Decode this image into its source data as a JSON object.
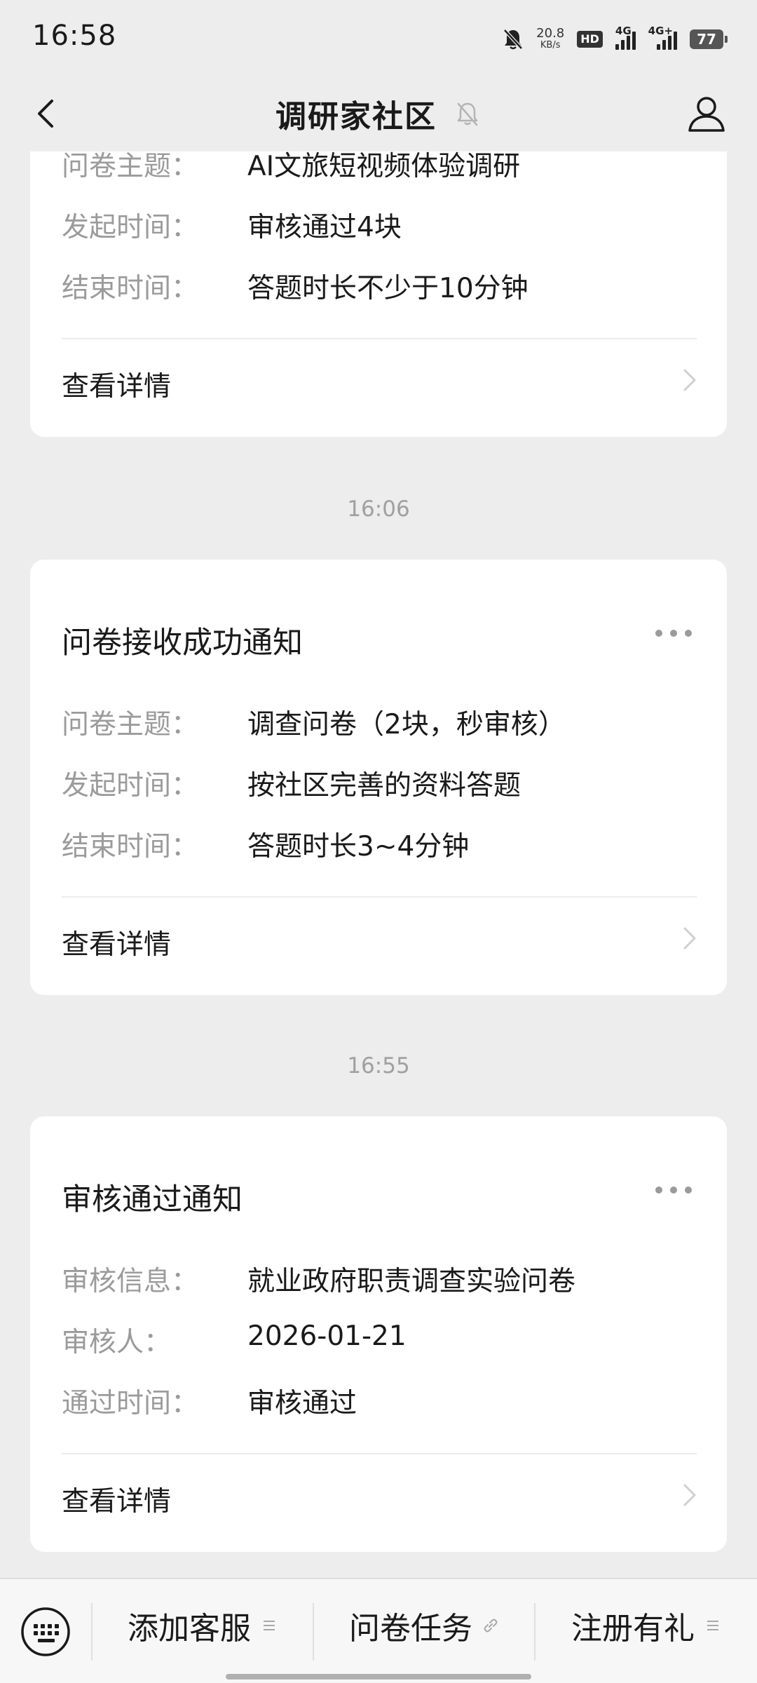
{
  "status_bar": {
    "time": "16:58",
    "net_speed_value": "20.8",
    "net_speed_unit": "KB/s",
    "hd_label": "HD",
    "sim1_label": "4G",
    "sim2_label": "4G+",
    "battery": "77"
  },
  "nav": {
    "title": "调研家社区"
  },
  "cards": [
    {
      "rows": [
        {
          "key": "问卷主题：",
          "value": "AI文旅短视频体验调研"
        },
        {
          "key": "发起时间：",
          "value": "审核通过4块"
        },
        {
          "key": "结束时间：",
          "value": "答题时长不少于10分钟"
        }
      ],
      "detail_label": "查看详情"
    },
    {
      "timestamp": "16:06",
      "title": "问卷接收成功通知",
      "rows": [
        {
          "key": "问卷主题：",
          "value": "调查问卷（2块，秒审核）"
        },
        {
          "key": "发起时间：",
          "value": "按社区完善的资料答题"
        },
        {
          "key": "结束时间：",
          "value": "答题时长3~4分钟"
        }
      ],
      "detail_label": "查看详情"
    },
    {
      "timestamp": "16:55",
      "title": "审核通过通知",
      "rows": [
        {
          "key": "审核信息：",
          "value": "就业政府职责调查实验问卷"
        },
        {
          "key": "审核人：",
          "value": "2026-01-21"
        },
        {
          "key": "通过时间：",
          "value": "审核通过"
        }
      ],
      "detail_label": "查看详情"
    }
  ],
  "bottom_menu": {
    "items": [
      {
        "label": "添加客服",
        "icon": "menu-lines-icon"
      },
      {
        "label": "问卷任务",
        "icon": "link-icon"
      },
      {
        "label": "注册有礼",
        "icon": "menu-lines-icon"
      }
    ]
  },
  "colors": {
    "background": "#ededed",
    "card": "#ffffff",
    "key_text": "#9b9b9b",
    "primary_text": "#1a1a1a"
  }
}
